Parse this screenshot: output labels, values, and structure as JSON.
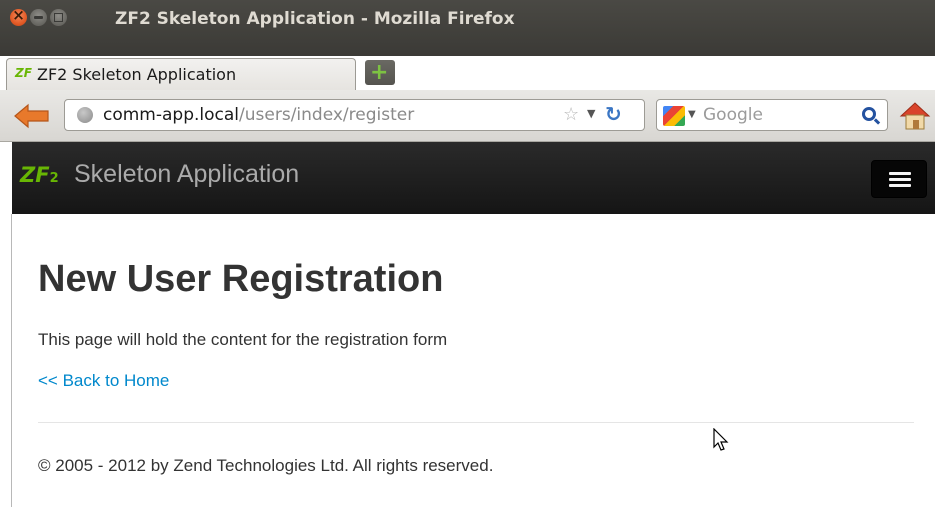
{
  "window": {
    "title": "ZF2 Skeleton Application - Mozilla Firefox"
  },
  "tabs": [
    {
      "favicon": "ZF",
      "label": "ZF2 Skeleton Application"
    }
  ],
  "newtab": {
    "label": "+"
  },
  "toolbar": {
    "url_host": "comm-app.local",
    "url_path": "/users/index/register",
    "search_engine": "Google"
  },
  "site": {
    "logo": {
      "text": "ZF",
      "sub": "2",
      "color": "#68b604"
    },
    "brand": "Skeleton Application"
  },
  "main": {
    "heading": "New User Registration",
    "lead": "This page will hold the content for the registration form",
    "back_link": "<< Back to Home"
  },
  "footer": {
    "text": "© 2005 - 2012 by Zend Technologies Ltd. All rights reserved."
  },
  "colors": {
    "link": "#0088cc",
    "navbar": "#1b1b1b",
    "text": "#333333"
  }
}
